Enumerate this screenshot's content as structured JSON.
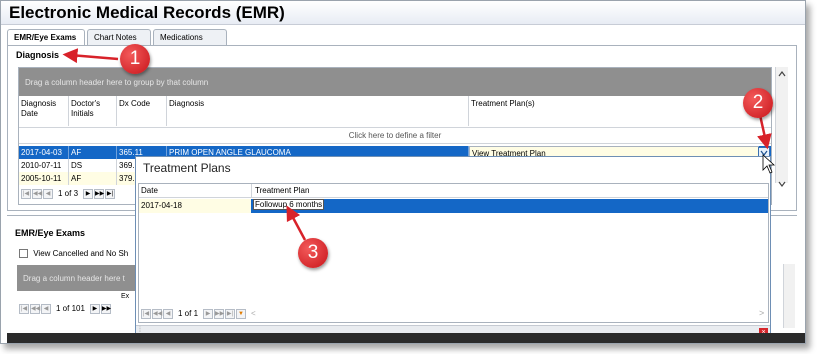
{
  "window": {
    "title": "Electronic Medical Records (EMR)"
  },
  "tabs": [
    {
      "label": "EMR/Eye Exams"
    },
    {
      "label": "Chart Notes"
    },
    {
      "label": "Medications"
    }
  ],
  "diagnosis": {
    "section_label": "Diagnosis",
    "group_hint": "Drag a column header here to group by that column",
    "filter_hint": "Click here to define a filter",
    "columns": [
      {
        "label": "Diagnosis\nDate"
      },
      {
        "label": "Doctor's\nInitials"
      },
      {
        "label": "Dx Code"
      },
      {
        "label": "Diagnosis"
      },
      {
        "label": "Treatment Plan(s)"
      }
    ],
    "rows": [
      {
        "date": "2017-04-03",
        "initials": "AF",
        "code": "365.11",
        "diagnosis": "PRIM OPEN ANGLE GLAUCOMA",
        "treatment": "View Treatment Plan"
      },
      {
        "date": "2010-07-11",
        "initials": "DS",
        "code": "369.",
        "diagnosis": "",
        "treatment": ""
      },
      {
        "date": "2005-10-11",
        "initials": "AF",
        "code": "379.",
        "diagnosis": "",
        "treatment": ""
      }
    ],
    "pager": {
      "text": "1 of 3"
    }
  },
  "lower": {
    "section_label": "EMR/Eye Exams",
    "checkbox_label": "View Cancelled and No Sh",
    "group_hint": "Drag a column header here t",
    "pager": {
      "text": "1 of 101"
    },
    "col_label": "Ex"
  },
  "treatment_popup": {
    "title": "Treatment Plans",
    "columns": [
      {
        "label": "Date"
      },
      {
        "label": "Treatment Plan"
      }
    ],
    "rows": [
      {
        "date": "2017-04-18",
        "plan": "Followup 6 months"
      }
    ],
    "pager": {
      "text": "1 of 1"
    }
  },
  "callouts": [
    {
      "label": "1"
    },
    {
      "label": "2"
    },
    {
      "label": "3"
    }
  ],
  "colors": {
    "selection": "#1467c6",
    "callout": "#d8222a",
    "group_panel": "#8f8f8f"
  }
}
